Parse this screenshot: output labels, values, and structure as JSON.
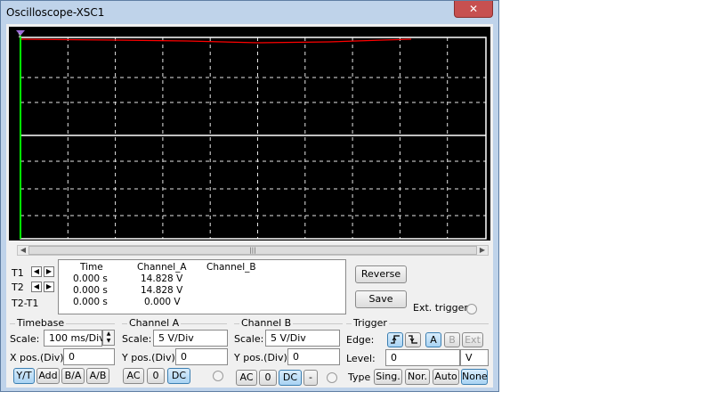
{
  "window": {
    "title": "Oscilloscope-XSC1",
    "close_label": "✕"
  },
  "cursors": {
    "t1": "T1",
    "t2": "T2",
    "t2t1": "T2-T1"
  },
  "readout": {
    "headers": {
      "time": "Time",
      "channel_a": "Channel_A",
      "channel_b": "Channel_B"
    },
    "rows": [
      {
        "time": "0.000 s",
        "channel_a": "14.828 V",
        "channel_b": ""
      },
      {
        "time": "0.000 s",
        "channel_a": "14.828 V",
        "channel_b": ""
      },
      {
        "time": "0.000 s",
        "channel_a": "0.000 V",
        "channel_b": ""
      }
    ]
  },
  "actions": {
    "reverse": "Reverse",
    "save": "Save",
    "ext_trigger": "Ext. trigger"
  },
  "timebase": {
    "title": "Timebase",
    "scale_label": "Scale:",
    "scale_value": "100 ms/Div",
    "xpos_label": "X pos.(Div):",
    "xpos_value": "0",
    "modes": [
      "Y/T",
      "Add",
      "B/A",
      "A/B"
    ],
    "active_mode": "Y/T"
  },
  "channel_a": {
    "title": "Channel A",
    "scale_label": "Scale:",
    "scale_value": "5  V/Div",
    "ypos_label": "Y pos.(Div):",
    "ypos_value": "0",
    "coupling": [
      "AC",
      "0",
      "DC"
    ],
    "active_coupling": "DC"
  },
  "channel_b": {
    "title": "Channel B",
    "scale_label": "Scale:",
    "scale_value": "5  V/Div",
    "ypos_label": "Y pos.(Div):",
    "ypos_value": "0",
    "coupling": [
      "AC",
      "0",
      "DC",
      "-"
    ],
    "active_coupling": "DC"
  },
  "trigger": {
    "title": "Trigger",
    "edge_label": "Edge:",
    "edge_sources": [
      "A",
      "B",
      "Ext"
    ],
    "active_source": "A",
    "level_label": "Level:",
    "level_value": "0",
    "level_unit": "V",
    "type_label": "Type",
    "types": [
      "Sing.",
      "Nor.",
      "Auto",
      "None"
    ],
    "active_type": "None"
  },
  "icons": {
    "rising_edge": "rising-edge-icon",
    "falling_edge": "falling-edge-icon",
    "left_arrow": "arrow-left-icon",
    "right_arrow": "arrow-right-icon",
    "cursor_marker": "cursor-marker-icon",
    "scroll_grip": "scroll-grip-icon"
  },
  "colors": {
    "screen_bg": "#000000",
    "channel_a_trace": "#ff0000",
    "channel_b_trace": "#ffffff",
    "cursor": "#00ff00",
    "grid": "#ffffff"
  }
}
